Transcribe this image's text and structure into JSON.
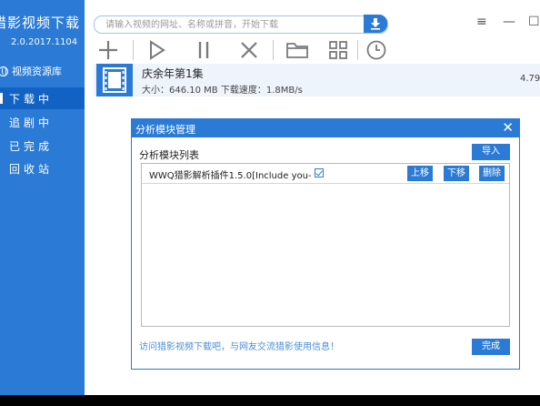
{
  "sidebar": {
    "title": "猎影视频下载",
    "version": "2.0.2017.1104",
    "resource_library": "视频资源库",
    "items": [
      {
        "label": "下载中",
        "active": true
      },
      {
        "label": "追剧中",
        "active": false
      },
      {
        "label": "已完成",
        "active": false
      },
      {
        "label": "回收站",
        "active": false
      }
    ]
  },
  "search": {
    "placeholder": "请输入视频的网址、名称或拼音，开始下载"
  },
  "window_controls": {
    "menu": "≡",
    "minimize": "—",
    "maximize": "☐"
  },
  "toolbar": [
    "add-icon",
    "play-icon",
    "pause-icon",
    "delete-icon",
    "folder-icon",
    "grid-icon",
    "clock-icon"
  ],
  "download": {
    "name": "庆余年第1集",
    "info": "大小：646.10 MB 下载速度：1.8MB/s",
    "percent": "4.79"
  },
  "modal": {
    "title": "分析模块管理",
    "close": "✕",
    "list_label": "分析模块列表",
    "import_label": "导入",
    "plugins": [
      {
        "name": "WWQ猎影解析插件1.5.0[Include you-",
        "checked": true
      }
    ],
    "move_up_label": "上移",
    "move_down_label": "下移",
    "delete_label": "删除",
    "footer_link": "访问猎影视频下载吧，与网友交流猎影使用信息！",
    "done_label": "完成"
  },
  "colors": {
    "accent": "#2b7bd6",
    "accent_dark": "#1262c4"
  }
}
